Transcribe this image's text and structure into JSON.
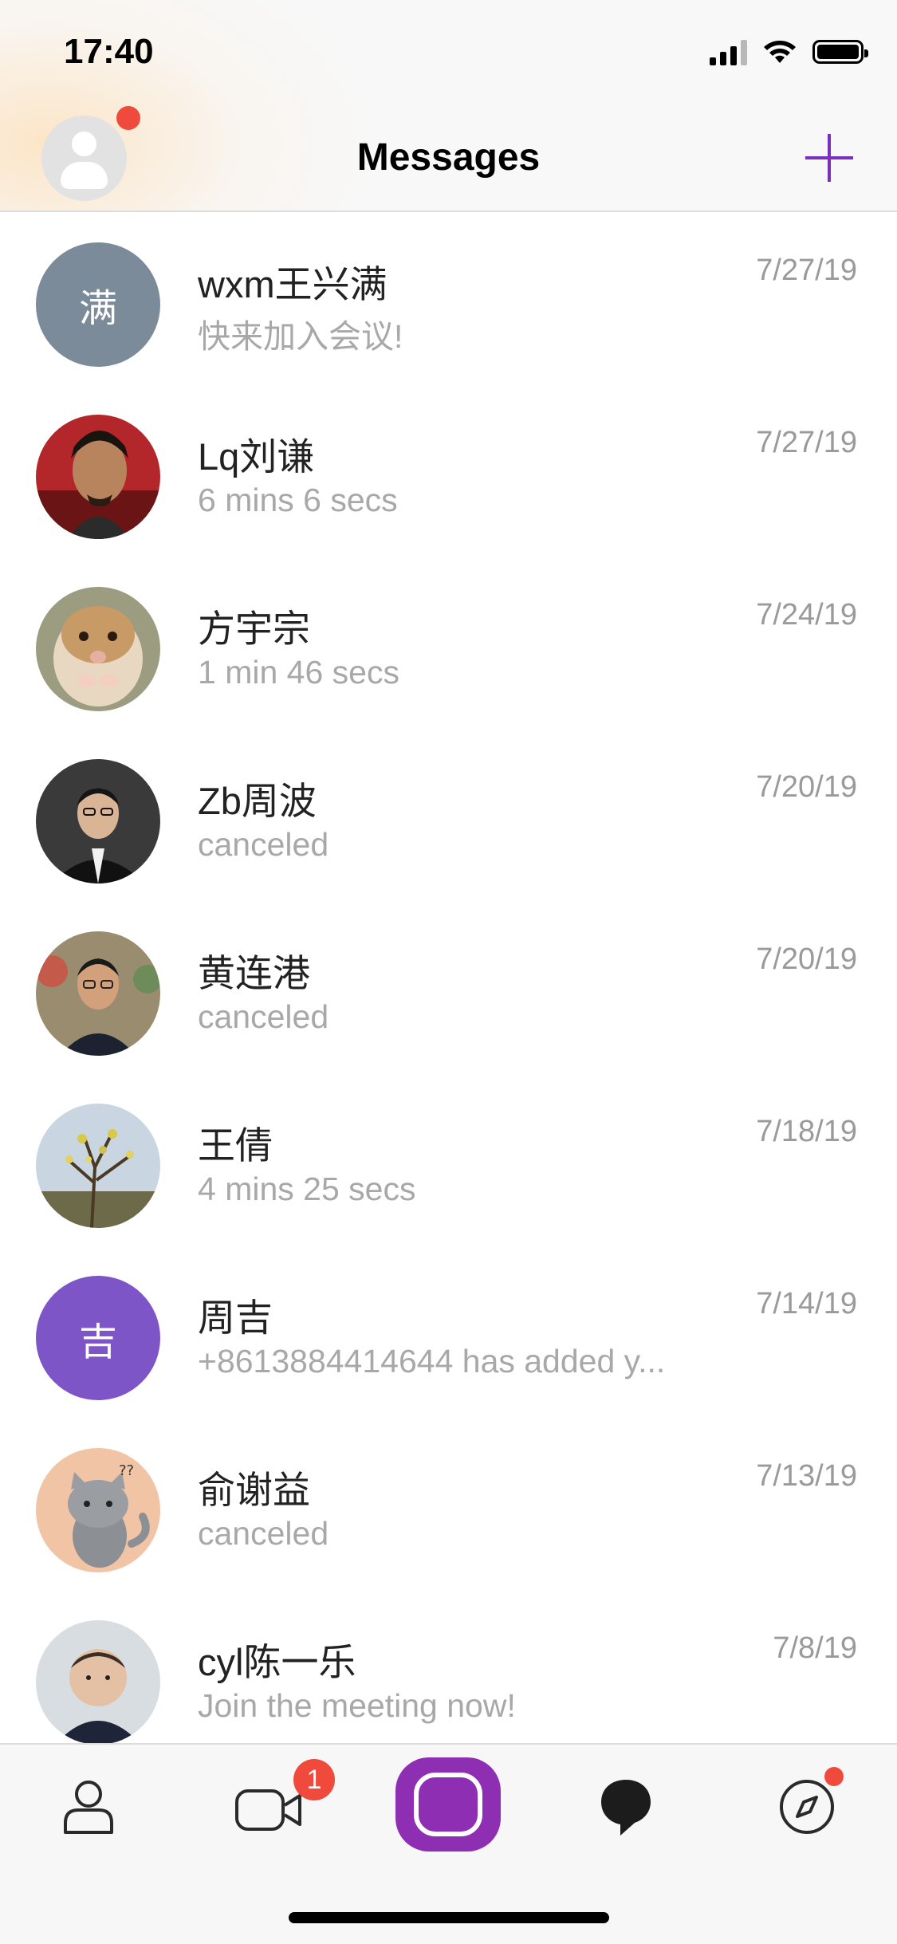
{
  "status_bar": {
    "time": "17:40"
  },
  "header": {
    "title": "Messages"
  },
  "messages": [
    {
      "name": "wxm王兴满",
      "preview": "快来加入会议!",
      "date": "7/27/19",
      "avatar": {
        "kind": "letter",
        "text": "满",
        "color": "#7b8b99"
      }
    },
    {
      "name": "Lq刘谦",
      "preview": "6 mins 6 secs",
      "date": "7/27/19",
      "avatar": {
        "kind": "photo",
        "subject": "man-portrait-red"
      }
    },
    {
      "name": "方宇宗",
      "preview": "1 min 46 secs",
      "date": "7/24/19",
      "avatar": {
        "kind": "photo",
        "subject": "hamster"
      }
    },
    {
      "name": "Zb周波",
      "preview": "canceled",
      "date": "7/20/19",
      "avatar": {
        "kind": "photo",
        "subject": "man-suit-dark"
      }
    },
    {
      "name": "黄连港",
      "preview": "canceled",
      "date": "7/20/19",
      "avatar": {
        "kind": "photo",
        "subject": "man-glasses-outdoor"
      }
    },
    {
      "name": "王倩",
      "preview": "4 mins 25 secs",
      "date": "7/18/19",
      "avatar": {
        "kind": "photo",
        "subject": "tree-sky"
      }
    },
    {
      "name": "周吉",
      "preview": "+8613884414644 has added y...",
      "date": "7/14/19",
      "avatar": {
        "kind": "letter",
        "text": "吉",
        "color": "#7d55c7"
      }
    },
    {
      "name": "俞谢益",
      "preview": "canceled",
      "date": "7/13/19",
      "avatar": {
        "kind": "photo",
        "subject": "cartoon-cat"
      }
    },
    {
      "name": "cyl陈一乐",
      "preview": "Join the meeting now!",
      "date": "7/8/19",
      "avatar": {
        "kind": "photo",
        "subject": "baby"
      }
    }
  ],
  "tabbar": {
    "tabs": [
      {
        "icon": "contacts-icon"
      },
      {
        "icon": "video-camera-icon",
        "badge": "1"
      },
      {
        "icon": "home-square-icon"
      },
      {
        "icon": "chat-bubble-icon"
      },
      {
        "icon": "compass-icon"
      }
    ]
  },
  "colors": {
    "accent": "#7b2fbe",
    "badge": "#ef4a3c",
    "muted_text": "#a8a8a8"
  }
}
